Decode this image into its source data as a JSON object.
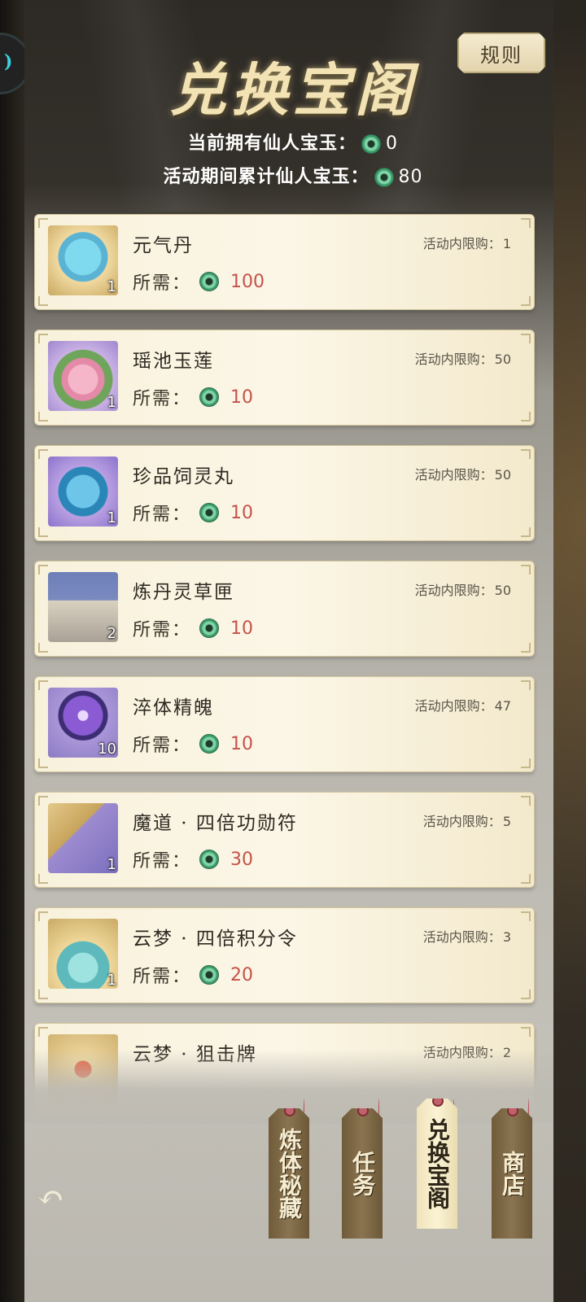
{
  "header": {
    "title": "兑换宝阁",
    "rules_label": "规则",
    "current_label": "当前拥有仙人宝玉：",
    "current_value": "0",
    "total_label": "活动期间累计仙人宝玉：",
    "total_value": "80"
  },
  "cost_label": "所需：",
  "limit_label": "活动内限购：",
  "items": [
    {
      "name": "元气丹",
      "limit": "1",
      "cost": "100",
      "qty": "1",
      "icon": "blue-pill-lotus-icon"
    },
    {
      "name": "瑶池玉莲",
      "limit": "50",
      "cost": "10",
      "qty": "1",
      "icon": "lotus-icon"
    },
    {
      "name": "珍品饲灵丸",
      "limit": "50",
      "cost": "10",
      "qty": "1",
      "icon": "blue-orb-icon"
    },
    {
      "name": "炼丹灵草匣",
      "limit": "50",
      "cost": "10",
      "qty": "2",
      "icon": "herb-box-icon"
    },
    {
      "name": "淬体精魄",
      "limit": "47",
      "cost": "10",
      "qty": "10",
      "icon": "purple-orb-icon"
    },
    {
      "name": "魔道 · 四倍功勋符",
      "limit": "5",
      "cost": "30",
      "qty": "1",
      "icon": "talisman-icon"
    },
    {
      "name": "云梦 · 四倍积分令",
      "limit": "3",
      "cost": "20",
      "qty": "1",
      "icon": "fan-token-icon"
    },
    {
      "name": "云梦 · 狙击牌",
      "limit": "2",
      "cost": "",
      "qty": "",
      "icon": "sword-token-icon"
    }
  ],
  "nav": [
    {
      "label": "炼体秘藏",
      "active": false
    },
    {
      "label": "任务",
      "active": false
    },
    {
      "label": "兑换宝阁",
      "active": true
    },
    {
      "label": "商店",
      "active": false
    }
  ],
  "back_icon": "back-arrow-icon",
  "colors": {
    "cost": "#c5524a",
    "title": "#f3e3b4",
    "coin": "#3b9c6b"
  }
}
